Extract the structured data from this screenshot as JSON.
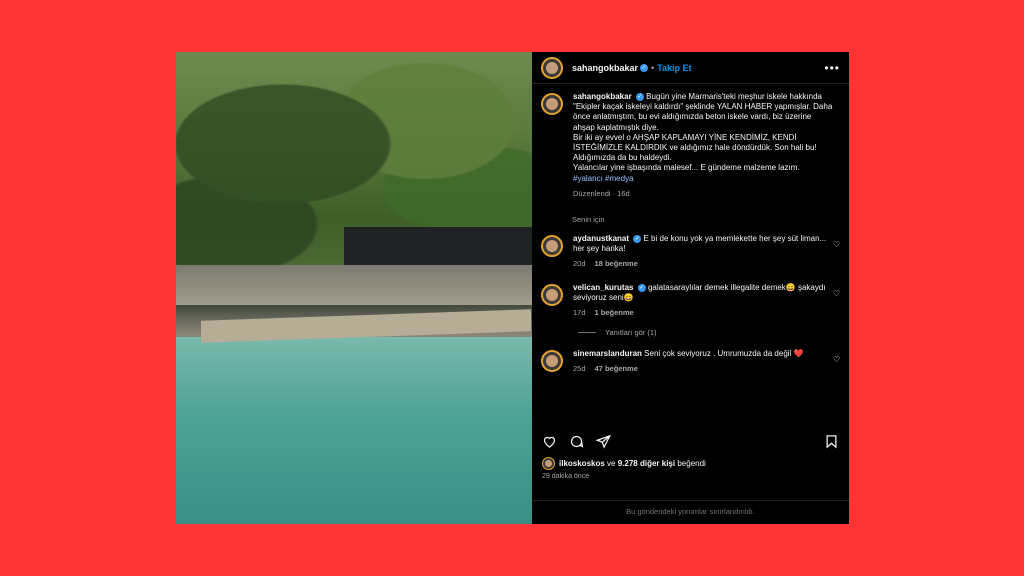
{
  "header": {
    "username": "sahangokbakar",
    "separator": "•",
    "follow_label": "Takip Et",
    "more_label": "•••"
  },
  "caption": {
    "username": "sahangokbakar",
    "text": "Bugün yine Marmaris'teki meşhur iskele hakkında \"Ekipler kaçak iskeleyi kaldırdı\" şeklinde YALAN HABER yapmışlar. Daha önce anlatmıştım, bu evi aldığımızda beton iskele vardı, biz üzerine ahşap kaplatmıştık diye.",
    "text2": "Bir iki ay evvel o AHŞAP KAPLAMAYI YİNE KENDİMİZ, KENDİ İSTEĞİMİZLE KALDIRDIK ve aldığımız hale döndürdük. Son hali bu! Aldığımızda da bu haldeydi.",
    "text3": "Yalancılar yine işbaşında malesef... E gündeme malzeme lazım.",
    "hashtags": "#yalancı #medya",
    "edited_meta": "Düzenlendi · 16d"
  },
  "for_you_label": "Senin için",
  "comments": [
    {
      "username": "aydanustkanat",
      "text": "E bi de konu yok ya memlekette her şey süt liman... her şey harika!",
      "time": "20d",
      "likes": "18 beğenme"
    },
    {
      "username": "velican_kurutas",
      "text": "galatasaraylılar demek illegalite demek😄 şakaydı seviyoruz seni😄",
      "time": "17d",
      "likes": "1 beğenme",
      "replies_label": "Yanıtları gör (1)"
    },
    {
      "username": "sinemarslanduran",
      "text": "Seni çok seviyoruz . Umrumuzda da değil ❤️",
      "time": "25d",
      "likes": "47 beğenme"
    }
  ],
  "likes_line": {
    "user": "ilkoskoskos",
    "connector": "ve",
    "others": "9.278 diğer kişi",
    "suffix": "beğendi"
  },
  "post_time": "29 dakika önce",
  "comments_limited": "Bu gönderideki yorumlar sınırlandırıldı.",
  "colors": {
    "background": "#fe3535",
    "panel": "#000000",
    "link_blue": "#0095f6",
    "verified": "#3897f0"
  },
  "icons": [
    "heart-icon",
    "comment-icon",
    "share-icon",
    "bookmark-icon",
    "verified-icon",
    "more-icon"
  ]
}
